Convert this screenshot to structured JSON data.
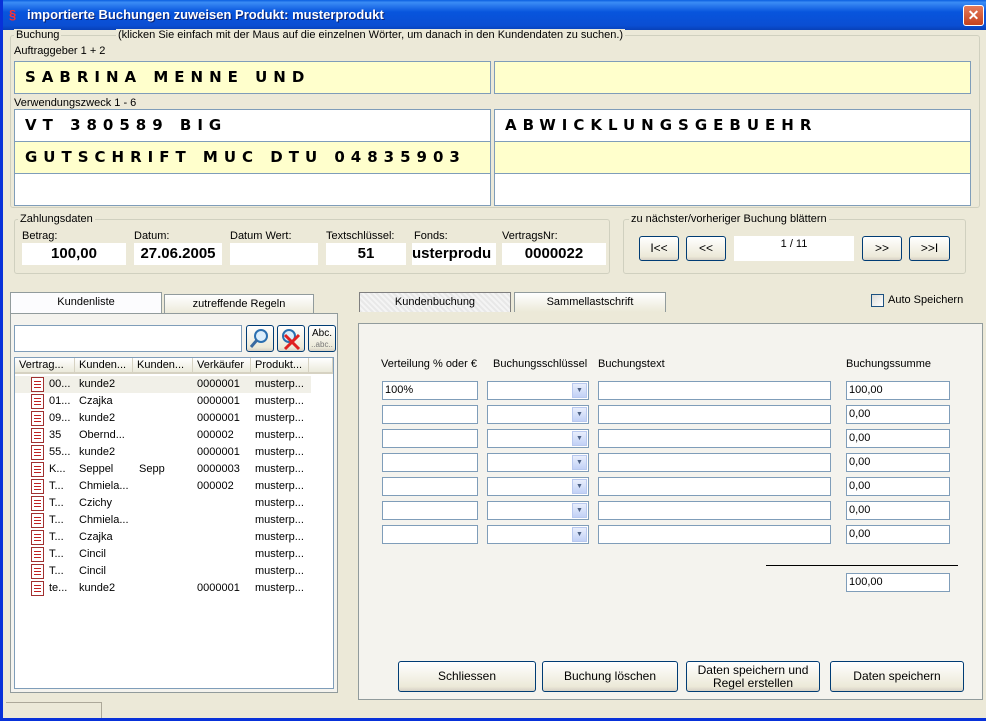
{
  "window": {
    "title": "importierte Buchungen zuweisen Produkt: musterprodukt",
    "close_glyph": "✕",
    "app_icon": "§"
  },
  "buchung": {
    "group_label": "Buchung",
    "hint": "(klicken Sie einfach mit der Maus auf die einzelnen Wörter, um danach in den Kundendaten zu suchen.)",
    "auftraggeber_label": "Auftraggeber 1 + 2",
    "auftraggeber": [
      "SABRINA MENNE UND",
      ""
    ],
    "verwendungszweck_label": "Verwendungszweck 1 - 6",
    "verwendungszweck": [
      "VT 380589 BIG",
      "ABWICKLUNGSGEBUEHR",
      "GUTSCHRIFT MUC DTU 04835903",
      "",
      "",
      ""
    ]
  },
  "zahlungsdaten": {
    "group_label": "Zahlungsdaten",
    "betrag_label": "Betrag:",
    "betrag": "100,00",
    "datum_label": "Datum:",
    "datum": "27.06.2005",
    "datum_wert_label": "Datum Wert:",
    "datum_wert": "",
    "textschluessel_label": "Textschlüssel:",
    "textschluessel": "51",
    "fonds_label": "Fonds:",
    "fonds": "usterprodu",
    "vertragsnr_label": "VertragsNr:",
    "vertragsnr": "0000022"
  },
  "navigation": {
    "group_label": "zu nächster/vorheriger Buchung blättern",
    "first": "I<<",
    "prev": "<<",
    "position": "1 / 11",
    "next": ">>",
    "last": ">>I"
  },
  "left_tabs": [
    "Kundenliste",
    "zutreffende Regeln"
  ],
  "search": {
    "value": "",
    "abc_label_top": "Abc.",
    "abc_label_bottom": "..abc.."
  },
  "kundenliste": {
    "columns": [
      "Vertrag...",
      "Kunden...",
      "Kunden...",
      "Verkäufer",
      "Produkt..."
    ],
    "rows": [
      [
        "00...",
        "kunde2",
        "",
        "0000001",
        "musterp..."
      ],
      [
        "01...",
        "Czajka",
        "",
        "0000001",
        "musterp..."
      ],
      [
        "09...",
        "kunde2",
        "",
        "0000001",
        "musterp..."
      ],
      [
        "35",
        "Obernd...",
        "",
        "000002",
        "musterp..."
      ],
      [
        "55...",
        "kunde2",
        "",
        "0000001",
        "musterp..."
      ],
      [
        "K...",
        "Seppel",
        "Sepp",
        "0000003",
        "musterp..."
      ],
      [
        "T...",
        "Chmiela...",
        "",
        "000002",
        "musterp..."
      ],
      [
        "T...",
        "Czichy",
        "",
        "",
        "musterp..."
      ],
      [
        "T...",
        "Chmiela...",
        "",
        "",
        "musterp..."
      ],
      [
        "T...",
        "Czajka",
        "",
        "",
        "musterp..."
      ],
      [
        "T...",
        "Cincil",
        "",
        "",
        "musterp..."
      ],
      [
        "T...",
        "Cincil",
        "",
        "",
        "musterp..."
      ],
      [
        "te...",
        "kunde2",
        "",
        "0000001",
        "musterp..."
      ]
    ]
  },
  "right_tabs": [
    "Kundenbuchung",
    "Sammellastschrift"
  ],
  "auto_speichern": {
    "label": "Auto Speichern",
    "checked": false
  },
  "verteilung": {
    "headers": {
      "verteilung": "Verteilung % oder €",
      "schluessel": "Buchungsschlüssel",
      "text": "Buchungstext",
      "summe": "Buchungssumme"
    },
    "rows": [
      {
        "verteilung": "100%",
        "schluessel": "",
        "text": "",
        "summe": "100,00"
      },
      {
        "verteilung": "",
        "schluessel": "",
        "text": "",
        "summe": "0,00"
      },
      {
        "verteilung": "",
        "schluessel": "",
        "text": "",
        "summe": "0,00"
      },
      {
        "verteilung": "",
        "schluessel": "",
        "text": "",
        "summe": "0,00"
      },
      {
        "verteilung": "",
        "schluessel": "",
        "text": "",
        "summe": "0,00"
      },
      {
        "verteilung": "",
        "schluessel": "",
        "text": "",
        "summe": "0,00"
      },
      {
        "verteilung": "",
        "schluessel": "",
        "text": "",
        "summe": "0,00"
      }
    ],
    "total": "100,00"
  },
  "actions": {
    "schliessen": "Schliessen",
    "loeschen": "Buchung löschen",
    "speichern_regel_1": "Daten speichern und",
    "speichern_regel_2": "Regel erstellen",
    "speichern": "Daten speichern"
  }
}
